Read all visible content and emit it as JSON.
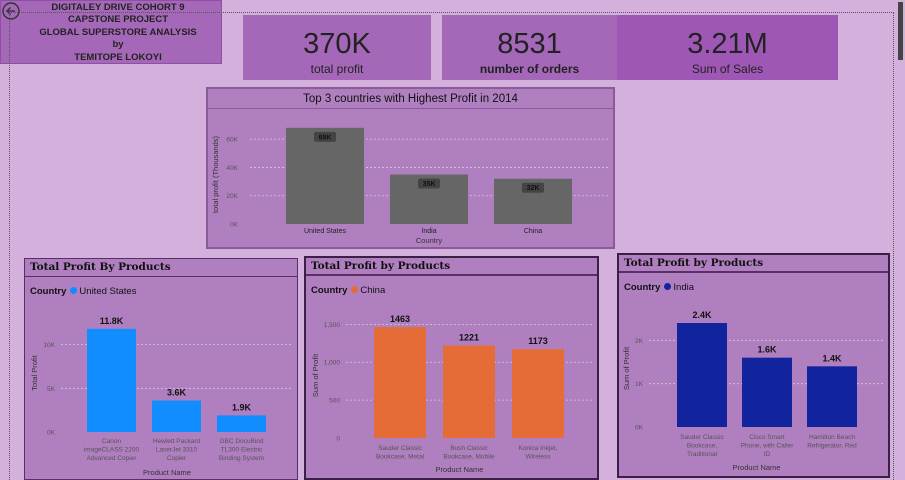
{
  "header": {
    "lines": [
      "DIGITALEY DRIVE COHORT 9",
      "CAPSTONE PROJECT",
      "GLOBAL SUPERSTORE ANALYSIS",
      "by",
      "TEMITOPE LOKOYI"
    ],
    "back_icon": "circle-arrow-left-icon"
  },
  "kpis": [
    {
      "value": "370K",
      "label": "total profit"
    },
    {
      "value": "8531",
      "label": "number of orders"
    },
    {
      "value": "3.21M",
      "label": "Sum of Sales"
    }
  ],
  "chart_data": [
    {
      "type": "bar",
      "title": "Top 3 countries with Highest Profit in 2014",
      "xlabel": "Country",
      "ylabel": "total profit (Thousands)",
      "categories": [
        "United States",
        "India",
        "China"
      ],
      "values": [
        68,
        35,
        32
      ],
      "data_labels": [
        "68K",
        "35K",
        "32K"
      ],
      "yticks": [
        0,
        20,
        40,
        60
      ],
      "ytick_labels": [
        "0K",
        "20K",
        "40K",
        "60K"
      ],
      "ylim": [
        0,
        70
      ],
      "color": "#666666",
      "grid": true
    },
    {
      "type": "bar",
      "title": "Total Profit By Products",
      "legend_title": "Country",
      "legend": "United States",
      "xlabel": "Product Name",
      "ylabel": "Total Profit",
      "categories": [
        [
          "Canon",
          "imageCLASS 2200",
          "Advanced Copier"
        ],
        [
          "Hewlett Packard",
          "LaserJet 3310",
          "Copier"
        ],
        [
          "GBC DocuBind",
          "TL300 Electric",
          "Binding System"
        ]
      ],
      "values": [
        11800,
        3600,
        1900
      ],
      "data_labels": [
        "11.8K",
        "3.6K",
        "1.9K"
      ],
      "yticks": [
        0,
        5000,
        10000
      ],
      "ytick_labels": [
        "0K",
        "5K",
        "10K"
      ],
      "ylim": [
        0,
        13500
      ],
      "color": "#118dff",
      "grid": true
    },
    {
      "type": "bar",
      "title": "Total Profit by Products",
      "legend_title": "Country",
      "legend": "China",
      "xlabel": "Product Name",
      "ylabel": "Sum of Profit",
      "categories": [
        [
          "Sauder Classic",
          "Bookcase, Metal"
        ],
        [
          "Bush Classic",
          "Bookcase, Mobile"
        ],
        [
          "Konica Inkjet,",
          "Wireless"
        ]
      ],
      "values": [
        1463,
        1221,
        1173
      ],
      "data_labels": [
        "1463",
        "1221",
        "1173"
      ],
      "yticks": [
        0,
        500,
        1000,
        1500
      ],
      "ytick_labels": [
        "0",
        "500",
        "1,000",
        "1,500"
      ],
      "ylim": [
        0,
        1650
      ],
      "color": "#e66c37",
      "grid": true
    },
    {
      "type": "bar",
      "title": "Total Profit by Products",
      "legend_title": "Country",
      "legend": "India",
      "xlabel": "Product Name",
      "ylabel": "Sum of Profit",
      "categories": [
        [
          "Sauder Classic",
          "Bookcase,",
          "Traditional"
        ],
        [
          "Cisco Smart",
          "Phone, with Caller",
          "ID"
        ],
        [
          "Hamilton Beach",
          "Refrigerator, Red"
        ]
      ],
      "values": [
        2400,
        1600,
        1400
      ],
      "data_labels": [
        "2.4K",
        "1.6K",
        "1.4K"
      ],
      "yticks": [
        0,
        1000,
        2000
      ],
      "ytick_labels": [
        "0K",
        "1K",
        "2K"
      ],
      "ylim": [
        0,
        2700
      ],
      "color": "#12239e",
      "grid": true
    }
  ]
}
